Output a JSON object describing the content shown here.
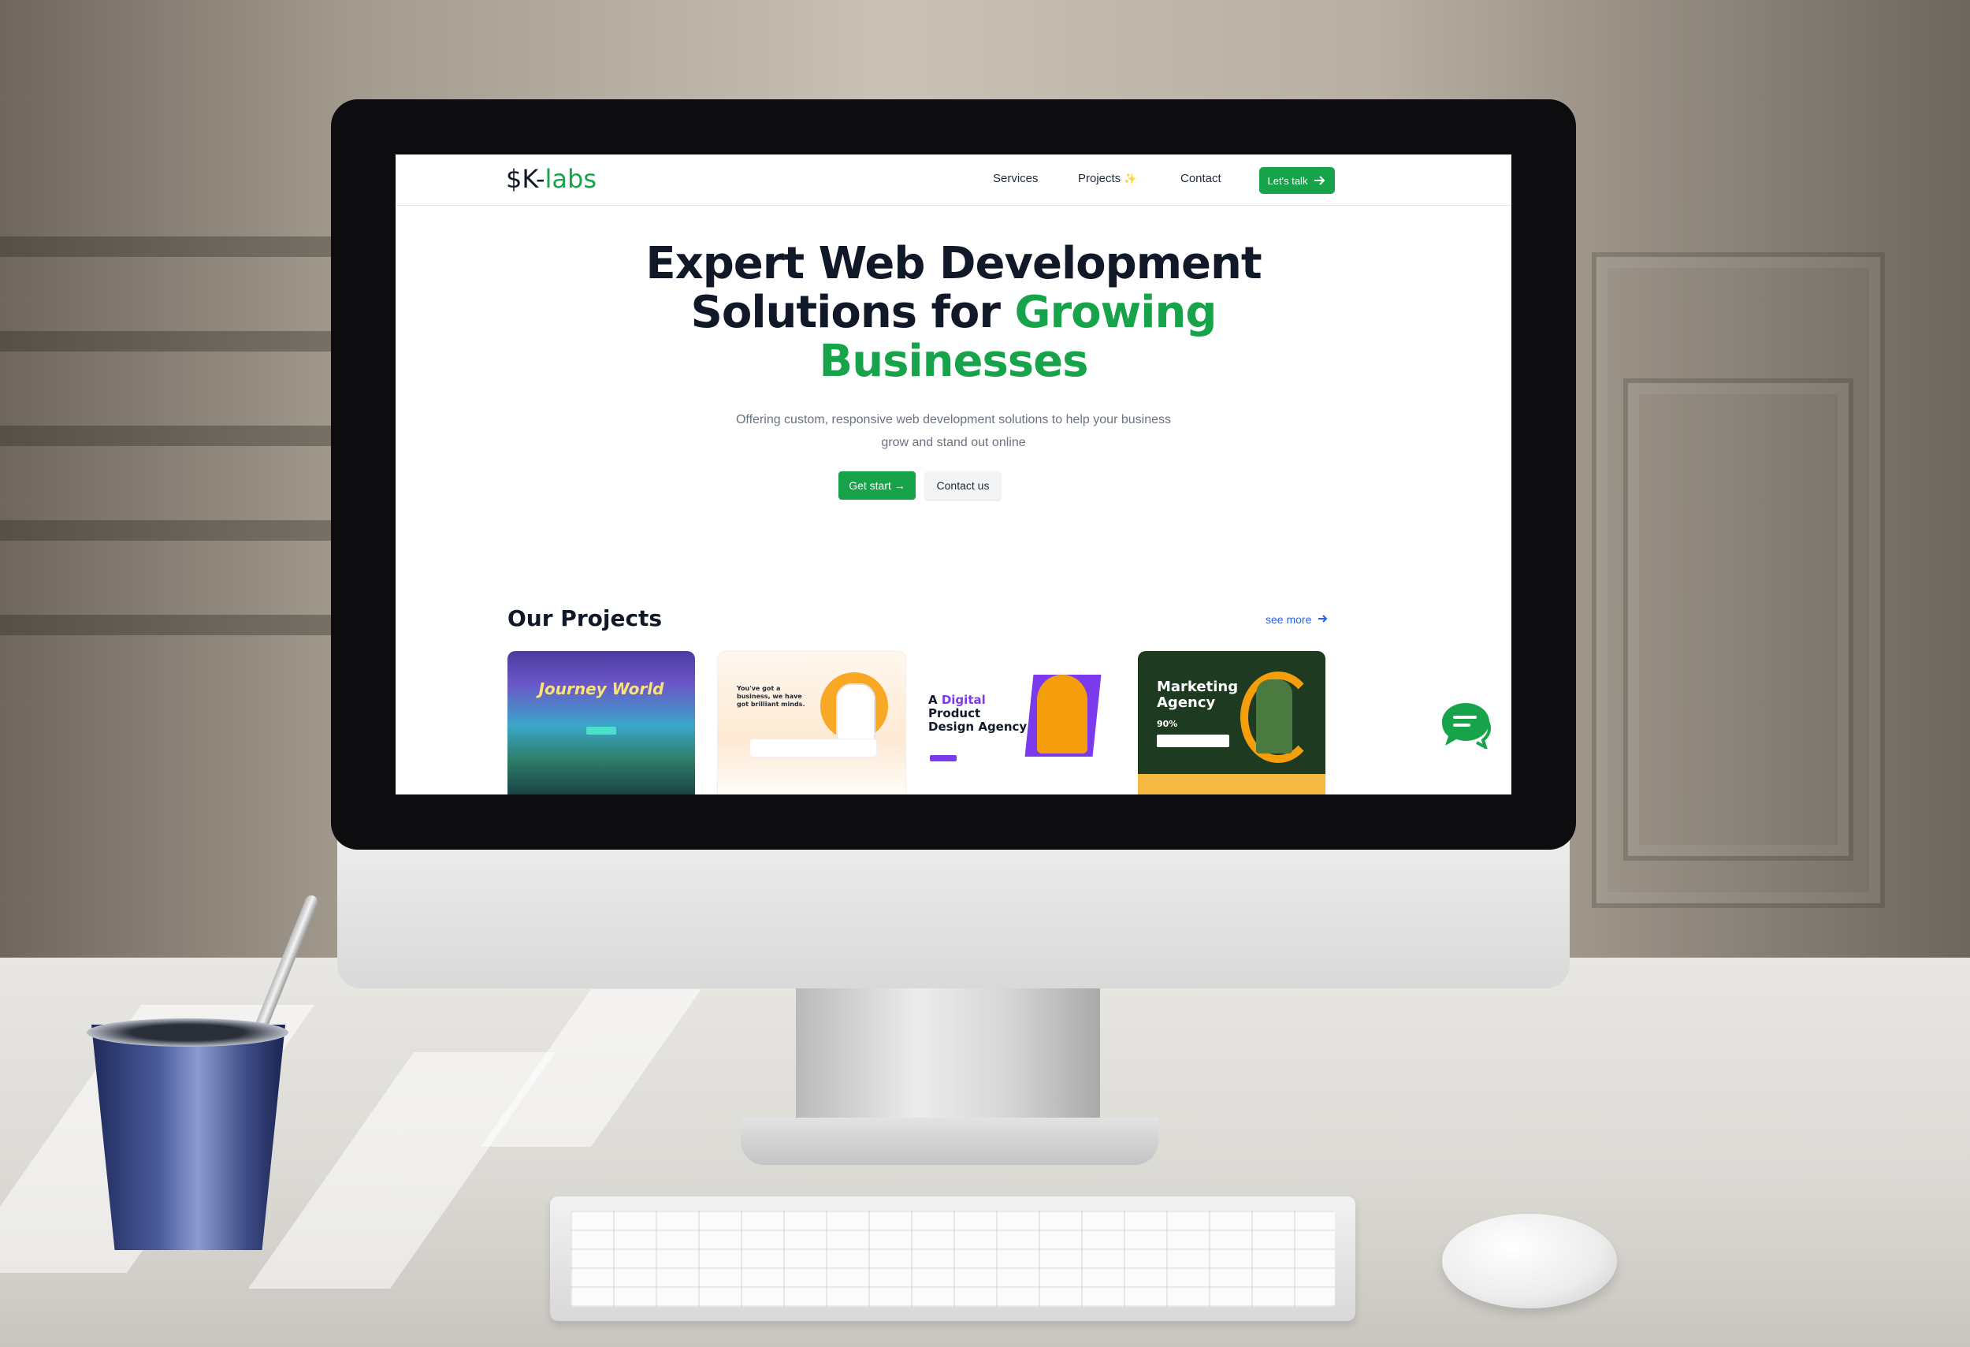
{
  "site": {
    "logo_prefix": "$K-",
    "logo_accent": "labs"
  },
  "nav": {
    "links": [
      "Services",
      "Projects",
      "Contact"
    ],
    "projects_icon": "✨",
    "cta_label": "Let's talk"
  },
  "hero": {
    "line1": "Expert Web Development",
    "line2_start": "Solutions for ",
    "line2_accent": "Growing",
    "line3_accent": "Businesses",
    "subtitle_line1": "Offering custom, responsive web development solutions to help your business",
    "subtitle_line2": "grow and stand out online",
    "primary_button": "Get start →",
    "secondary_button": "Contact us"
  },
  "projects": {
    "title": "Our Projects",
    "see_more": "see more",
    "cards": [
      {
        "heading": "Journey World"
      },
      {
        "heading": "You've got a business, we have got brilliant minds."
      },
      {
        "heading_start": "A ",
        "heading_accent": "Digital",
        "heading_end": " Product Design Agency"
      },
      {
        "heading": "Marketing Agency",
        "stat": "90%"
      }
    ]
  },
  "colors": {
    "accent": "#16a34a",
    "text_dark": "#111827",
    "link_blue": "#2563eb"
  },
  "icons": {
    "cta_arrow": "arrow-right-icon",
    "see_more_arrow": "arrow-right-icon",
    "chat": "chat-bubble-icon"
  }
}
